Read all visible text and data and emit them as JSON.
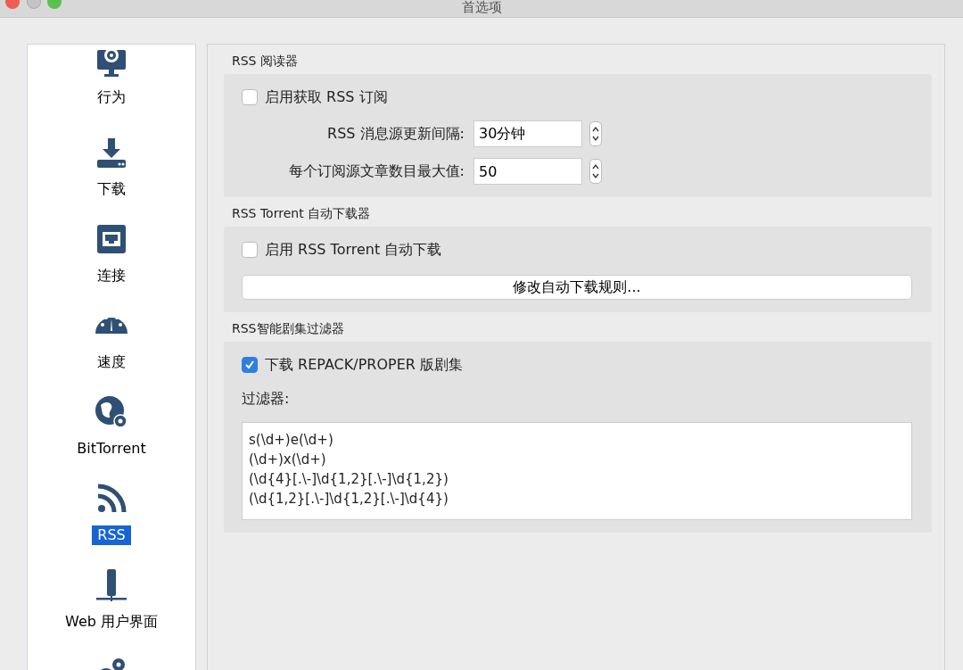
{
  "window": {
    "title": "首选项"
  },
  "sidebar": {
    "items": [
      {
        "label": "行为",
        "selected": false
      },
      {
        "label": "下载",
        "selected": false
      },
      {
        "label": "连接",
        "selected": false
      },
      {
        "label": "速度",
        "selected": false
      },
      {
        "label": "BitTorrent",
        "selected": false
      },
      {
        "label": "RSS",
        "selected": true
      },
      {
        "label": "Web 用户界面",
        "selected": false
      },
      {
        "selected": false
      }
    ]
  },
  "rss_reader": {
    "title": "RSS 阅读器",
    "enable": {
      "label": "启用获取 RSS 订阅",
      "checked": false
    },
    "fields": [
      {
        "label": "RSS 消息源更新间隔:",
        "value": "30分钟"
      },
      {
        "label": "每个订阅源文章数目最大值:",
        "value": "50"
      }
    ]
  },
  "auto_downloader": {
    "title": "RSS Torrent 自动下载器",
    "enable": {
      "label": "启用 RSS Torrent 自动下载",
      "checked": false
    },
    "button": "修改自动下载规则..."
  },
  "episode_filter": {
    "title": "RSS智能剧集过滤器",
    "enable": {
      "label": "下载 REPACK/PROPER 版剧集",
      "checked": true
    },
    "filter_label": "过滤器:",
    "filter_value": "s(\\d+)e(\\d+)\n(\\d+)x(\\d+)\n(\\d{4}[.\\-]\\d{1,2}[.\\-]\\d{1,2})\n(\\d{1,2}[.\\-]\\d{1,2}[.\\-]\\d{4})"
  }
}
